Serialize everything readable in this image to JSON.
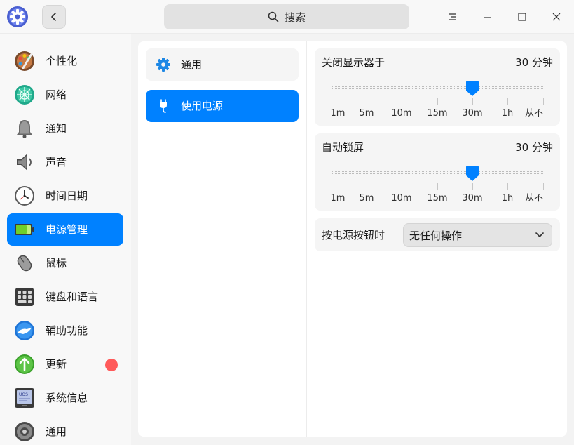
{
  "titlebar": {
    "search_label": "搜索",
    "icons": {
      "logo": "settings-gear-logo-icon",
      "back": "chevron-left-icon",
      "search": "search-icon",
      "menu": "menu-icon",
      "minimize": "minimize-icon",
      "maximize": "maximize-icon",
      "close": "close-icon"
    }
  },
  "sidebar": {
    "items": [
      {
        "label": "个性化",
        "icon": "personalization-palette-icon"
      },
      {
        "label": "网络",
        "icon": "network-globe-icon"
      },
      {
        "label": "通知",
        "icon": "bell-icon"
      },
      {
        "label": "声音",
        "icon": "speaker-icon"
      },
      {
        "label": "时间日期",
        "icon": "clock-icon"
      },
      {
        "label": "电源管理",
        "icon": "battery-icon",
        "active": true
      },
      {
        "label": "鼠标",
        "icon": "mouse-icon"
      },
      {
        "label": "键盘和语言",
        "icon": "keyboard-icon"
      },
      {
        "label": "辅助功能",
        "icon": "accessibility-icon"
      },
      {
        "label": "更新",
        "icon": "update-arrow-icon",
        "badge": true
      },
      {
        "label": "系统信息",
        "icon": "system-info-icon"
      },
      {
        "label": "通用",
        "icon": "general-gear-icon"
      }
    ]
  },
  "subnav": {
    "general": {
      "label": "通用",
      "icon": "gear-icon"
    },
    "power": {
      "label": "使用电源",
      "icon": "power-plug-icon"
    }
  },
  "screen_off": {
    "title": "关闭显示器于",
    "value": "30 分钟",
    "ticks": [
      "1m",
      "5m",
      "10m",
      "15m",
      "30m",
      "1h",
      "从不"
    ],
    "selected_index": 4
  },
  "auto_lock": {
    "title": "自动锁屏",
    "value": "30 分钟",
    "ticks": [
      "1m",
      "5m",
      "10m",
      "15m",
      "30m",
      "1h",
      "从不"
    ],
    "selected_index": 4
  },
  "power_button": {
    "label": "按电源按钮时",
    "selected": "无任何操作"
  },
  "colors": {
    "accent": "#0081ff",
    "badge": "#ff5a5a"
  }
}
